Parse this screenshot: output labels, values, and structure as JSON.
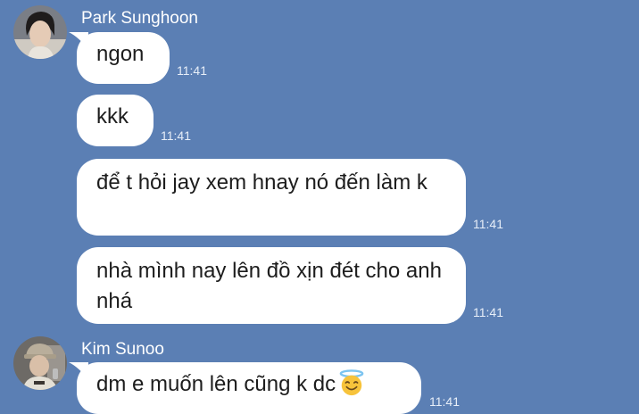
{
  "colors": {
    "background": "#5b7fb4",
    "bubble": "#ffffff",
    "text": "#1d1d1d",
    "timestamp": "#e7eef8"
  },
  "groups": [
    {
      "sender": "Park Sunghoon",
      "avatar_icon": "profile-photo",
      "messages": [
        {
          "text": "ngon",
          "time": "11:41"
        },
        {
          "text": "kkk",
          "time": "11:41"
        },
        {
          "text": "để t hỏi jay xem hnay nó đến làm k",
          "time": "11:41"
        },
        {
          "text": "nhà mình nay lên đồ xịn đét cho anh nhá",
          "time": "11:41"
        }
      ]
    },
    {
      "sender": "Kim Sunoo",
      "avatar_icon": "profile-photo",
      "messages": [
        {
          "text": "dm e muốn lên cũng k dc",
          "emoji": "smiling-face-with-halo-emoji",
          "time": "11:41"
        }
      ]
    }
  ]
}
